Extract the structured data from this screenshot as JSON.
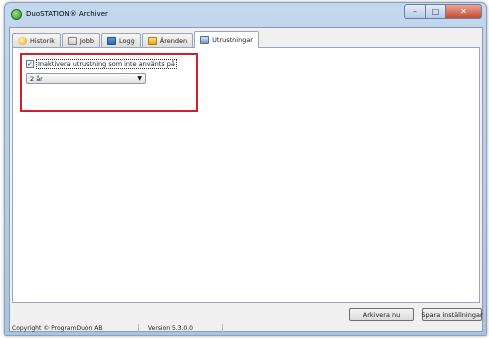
{
  "window": {
    "title": "DuoSTATION® Archiver",
    "controls": {
      "minimize": "–",
      "maximize": "□",
      "close": "✕"
    }
  },
  "tabs": [
    {
      "label": "Historik",
      "icon": "history-icon",
      "active": false
    },
    {
      "label": "Jobb",
      "icon": "job-icon",
      "active": false
    },
    {
      "label": "Logg",
      "icon": "log-icon",
      "active": false
    },
    {
      "label": "Ärenden",
      "icon": "case-icon",
      "active": false
    },
    {
      "label": "Utrustningar",
      "icon": "equipment-icon",
      "active": true
    }
  ],
  "settings": {
    "deactivate_checkbox": {
      "checked": true,
      "label": "Inaktivera utrustning som inte använts på",
      "check_glyph": "✓"
    },
    "period_select": {
      "value": "2 år",
      "arrow": "▼"
    },
    "highlight_color": "#d2202a"
  },
  "buttons": {
    "archive_now": "Arkivera nu",
    "save_settings": "Spara inställningar"
  },
  "statusbar": {
    "copyright": "Copyright © ProgramDuon AB",
    "version": "Version 5.3.0.0"
  }
}
